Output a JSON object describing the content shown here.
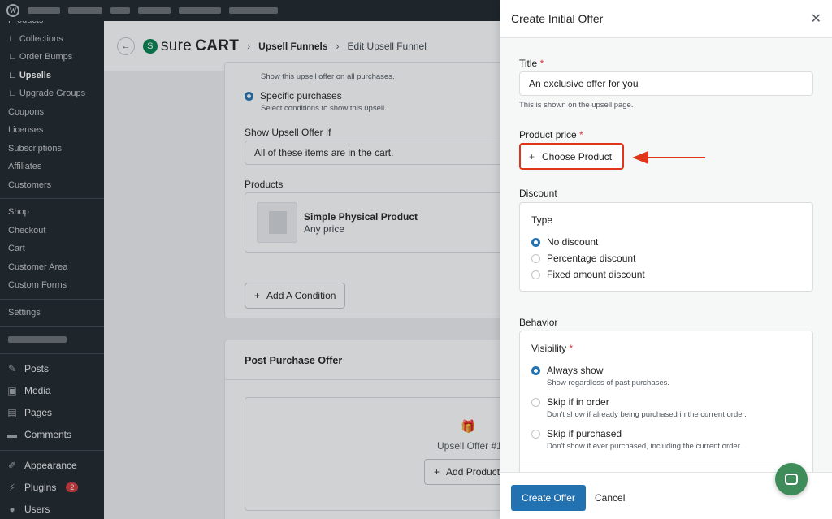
{
  "sidebar": {
    "submenu": [
      {
        "label": "Products",
        "active": false
      },
      {
        "label": "∟ Collections",
        "active": false
      },
      {
        "label": "∟ Order Bumps",
        "active": false
      },
      {
        "label": "∟ Upsells",
        "active": true
      },
      {
        "label": "∟ Upgrade Groups",
        "active": false
      },
      {
        "label": "Coupons",
        "active": false
      },
      {
        "label": "Licenses",
        "active": false
      },
      {
        "label": "Subscriptions",
        "active": false
      },
      {
        "label": "Affiliates",
        "active": false
      },
      {
        "label": "Customers",
        "active": false
      }
    ],
    "submenu2": [
      "Shop",
      "Checkout",
      "Cart",
      "Customer Area",
      "Custom Forms"
    ],
    "settings": "Settings",
    "main_menu": [
      {
        "label": "Posts",
        "icon": "pin-icon"
      },
      {
        "label": "Media",
        "icon": "media-icon"
      },
      {
        "label": "Pages",
        "icon": "pages-icon"
      },
      {
        "label": "Comments",
        "icon": "comments-icon"
      },
      {
        "label": "Appearance",
        "icon": "appearance-icon"
      },
      {
        "label": "Plugins",
        "icon": "plugins-icon",
        "badge": "2"
      },
      {
        "label": "Users",
        "icon": "users-icon"
      }
    ]
  },
  "header": {
    "brand": "sure",
    "brand_bold": "CART",
    "breadcrumb_1": "Upsell Funnels",
    "separator": "›",
    "breadcrumb_2": "Edit Upsell Funnel"
  },
  "page": {
    "show_all_desc": "Show this upsell offer on all purchases.",
    "specific_label": "Specific purchases",
    "specific_desc": "Select conditions to show this upsell.",
    "show_if_label": "Show Upsell Offer If",
    "show_if_value": "All of these items are in the cart.",
    "products_label": "Products",
    "product_name": "Simple Physical Product",
    "product_price": "Any price",
    "add_condition": "Add A Condition",
    "post_purchase_title": "Post Purchase Offer",
    "upsell_offer_label": "Upsell Offer #1",
    "add_product": "Add Product"
  },
  "modal": {
    "title": "Create Initial Offer",
    "title_label": "Title",
    "title_value": "An exclusive offer for you",
    "title_help": "This is shown on the upsell page.",
    "product_price_label": "Product price",
    "choose_product": "Choose Product",
    "discount_label": "Discount",
    "type_label": "Type",
    "discount_options": [
      "No discount",
      "Percentage discount",
      "Fixed amount discount"
    ],
    "behavior_label": "Behavior",
    "visibility_label": "Visibility",
    "visibility_options": [
      {
        "label": "Always show",
        "desc": "Show regardless of past purchases."
      },
      {
        "label": "Skip if in order",
        "desc": "Don't show if already being purchased in the current order."
      },
      {
        "label": "Skip if purchased",
        "desc": "Don't show if ever purchased, including the current order."
      }
    ],
    "create_button": "Create Offer",
    "cancel_button": "Cancel",
    "required_mark": "*"
  },
  "colors": {
    "primary": "#2271b1",
    "annotation": "#e0351b",
    "sidebar": "#1d2327"
  }
}
